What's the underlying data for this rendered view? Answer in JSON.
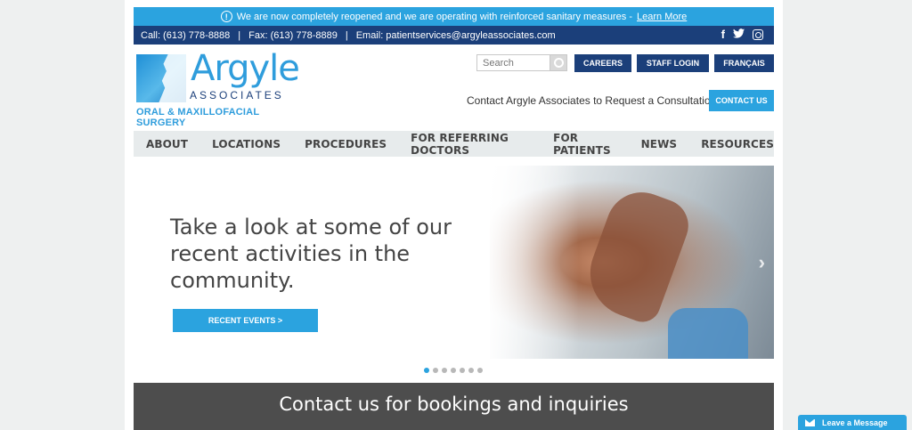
{
  "announcement": {
    "icon": "info-icon",
    "text": "We are now completely reopened and we are operating with reinforced sanitary measures - ",
    "link": "Learn More"
  },
  "contact_bar": {
    "call": "Call: (613) 778-8888",
    "fax": "Fax: (613) 778-8889",
    "email": "Email: patientservices@argyleassociates.com",
    "separator": "|"
  },
  "social": {
    "facebook_glyph": "f",
    "twitter_glyph": "🐦",
    "icons": [
      "facebook-icon",
      "twitter-icon",
      "instagram-icon"
    ]
  },
  "logo": {
    "name": "Argyle",
    "sub": "ASSOCIATES",
    "tagline": "ORAL & MAXILLOFACIAL SURGERY"
  },
  "search": {
    "placeholder": "Search"
  },
  "top_buttons": {
    "careers": "CAREERS",
    "staff_login": "STAFF LOGIN",
    "francais": "FRANÇAIS"
  },
  "consult": {
    "text": "Contact Argyle Associates to Request a Consultation!",
    "button": "CONTACT US"
  },
  "nav": [
    "ABOUT",
    "LOCATIONS",
    "PROCEDURES",
    "FOR REFERRING DOCTORS",
    "FOR PATIENTS",
    "NEWS",
    "RESOURCES"
  ],
  "hero": {
    "headline": "Take a look at some of our recent activities in the community.",
    "button": "RECENT EVENTS >",
    "next_glyph": "›"
  },
  "slider": {
    "total": 7,
    "active": 1
  },
  "footer_band": {
    "text": "Contact us for bookings and inquiries"
  },
  "chat": {
    "label": "Leave a Message"
  },
  "colors": {
    "accent": "#2ba3df",
    "navy": "#1b3f7a",
    "band": "#4d4d4d"
  }
}
